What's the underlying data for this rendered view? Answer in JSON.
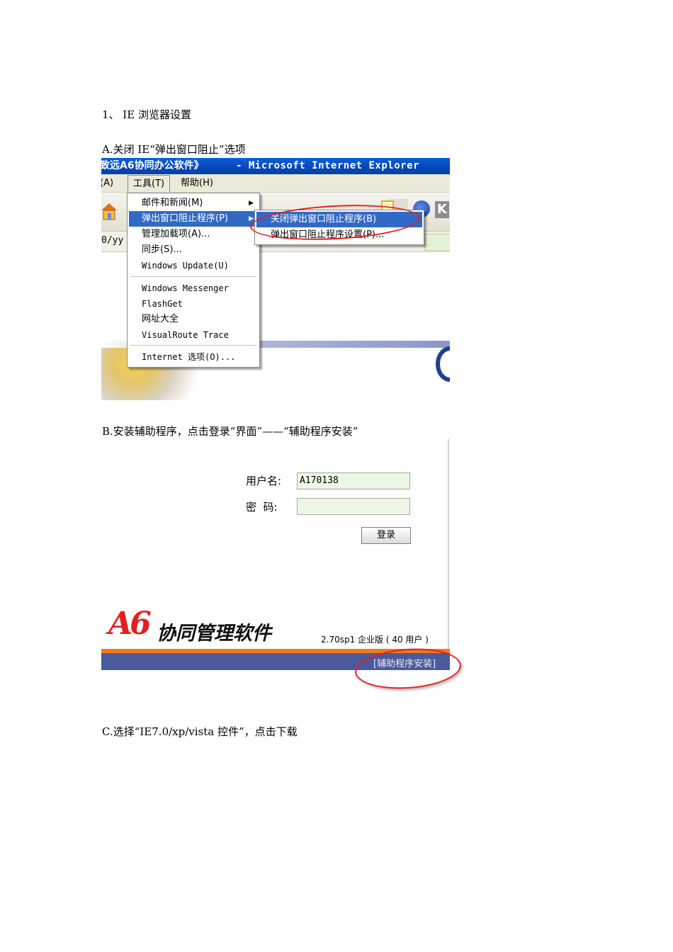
{
  "doc": {
    "heading": "1、 IE 浏览器设置",
    "step_a": "A.关闭 IE“弹出窗口阻止”选项",
    "step_b": "B.安装辅助程序，点击登录“界面”——“辅助程序安装”",
    "step_c": "C.选择“IE7.0/xp/vista 控件”，点击下载"
  },
  "ie_window": {
    "title_left": "致远A6协同办公软件》",
    "title_right": "- Microsoft Internet Explorer",
    "menubar": {
      "partial_item": "(A)",
      "tools": "工具(T)",
      "help": "帮助(H)"
    },
    "address_partial": "0/yy",
    "tools_menu": [
      "邮件和新闻(M)",
      "弹出窗口阻止程序(P)",
      "管理加载项(A)...",
      "同步(S)...",
      "Windows Update(U)",
      "Windows Messenger",
      "FlashGet",
      "网址大全",
      "VisualRoute Trace",
      "Internet 选项(O)..."
    ],
    "popup_submenu": [
      "关闭弹出窗口阻止程序(B)",
      "弹出窗口阻止程序设置(P)..."
    ],
    "icon_k": "K"
  },
  "login": {
    "username_label": "用户名:",
    "username_value": "A170138",
    "password_label": "密  码:",
    "password_value": "",
    "login_button": "登录",
    "logo_a6": "A6",
    "logo_text": "协同管理软件",
    "version": "2.70sp1 企业版 ( 40 用户 )",
    "helper_link": "[辅助程序安装]"
  },
  "colors": {
    "title_bar": "#0846b8",
    "menu_highlight": "#316ac5",
    "annotation_circle": "#e02020",
    "login_band": "#4a5a9a",
    "accent_orange": "#ee7a1e"
  }
}
